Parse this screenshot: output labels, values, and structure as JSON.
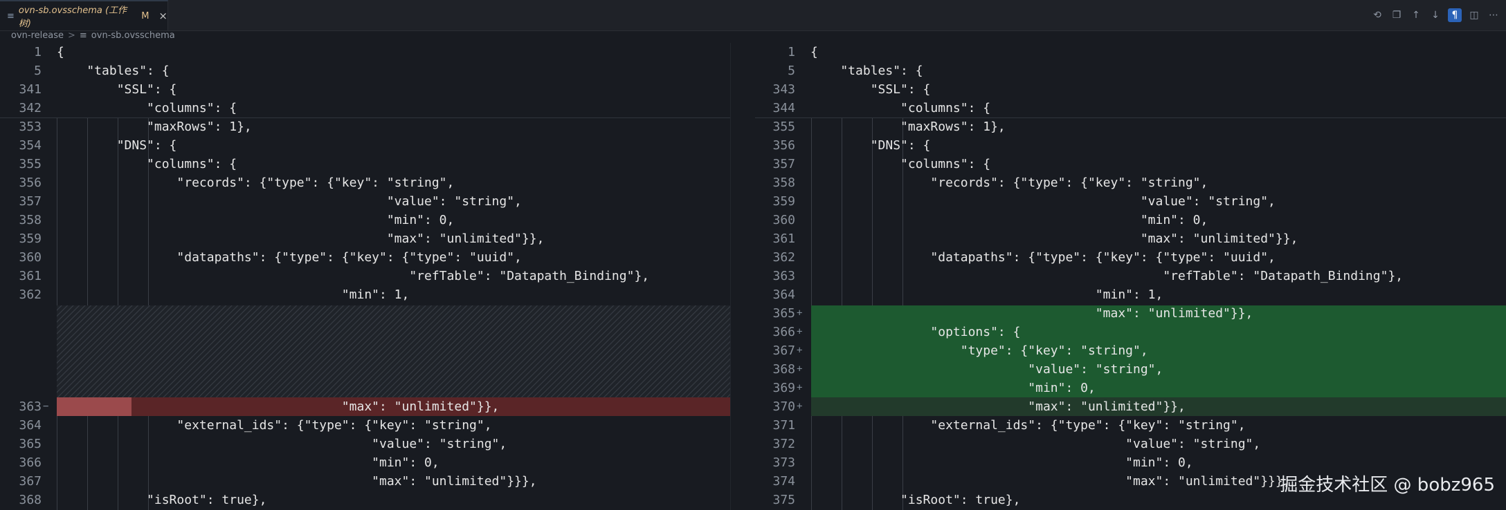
{
  "tab": {
    "file_icon": "≡",
    "label": "ovn-sb.ovsschema (工作树)",
    "badge": "M",
    "close": "×"
  },
  "actions": [
    {
      "name": "history-icon",
      "glyph": "⟲"
    },
    {
      "name": "open-file-icon",
      "glyph": "❐"
    },
    {
      "name": "previous-change-icon",
      "glyph": "↑"
    },
    {
      "name": "next-change-icon",
      "glyph": "↓"
    },
    {
      "name": "whitespace-toggle-icon",
      "glyph": "¶"
    },
    {
      "name": "inline-view-icon",
      "glyph": "◫"
    },
    {
      "name": "more-actions-icon",
      "glyph": "⋯"
    }
  ],
  "breadcrumb": {
    "folder": "ovn-release",
    "separator": ">",
    "file_icon": "≡",
    "file": "ovn-sb.ovsschema"
  },
  "left_lines": [
    {
      "num": "1",
      "code": "{"
    },
    {
      "num": "5",
      "code": "    \"tables\": {"
    },
    {
      "num": "341",
      "code": "        \"SSL\": {"
    },
    {
      "num": "342",
      "code": "            \"columns\": {"
    },
    {
      "num": "353",
      "code": "            \"maxRows\": 1},"
    },
    {
      "num": "354",
      "code": "        \"DNS\": {"
    },
    {
      "num": "355",
      "code": "            \"columns\": {"
    },
    {
      "num": "356",
      "code": "                \"records\": {\"type\": {\"key\": \"string\","
    },
    {
      "num": "357",
      "code": "                                            \"value\": \"string\","
    },
    {
      "num": "358",
      "code": "                                            \"min\": 0,"
    },
    {
      "num": "359",
      "code": "                                            \"max\": \"unlimited\"}},"
    },
    {
      "num": "360",
      "code": "                \"datapaths\": {\"type\": {\"key\": {\"type\": \"uuid\","
    },
    {
      "num": "361",
      "code": "                                               \"refTable\": \"Datapath_Binding\"},"
    },
    {
      "num": "362",
      "code": "                                      \"min\": 1,"
    },
    {
      "num": "363",
      "code": "                                      \"max\": \"unlimited\"}},"
    },
    {
      "num": "364",
      "code": "                \"external_ids\": {\"type\": {\"key\": \"string\","
    },
    {
      "num": "365",
      "code": "                                          \"value\": \"string\","
    },
    {
      "num": "366",
      "code": "                                          \"min\": 0,"
    },
    {
      "num": "367",
      "code": "                                          \"max\": \"unlimited\"}}},"
    },
    {
      "num": "368",
      "code": "            \"isRoot\": true},"
    }
  ],
  "right_lines": [
    {
      "num": "1",
      "code": "{"
    },
    {
      "num": "5",
      "code": "    \"tables\": {"
    },
    {
      "num": "343",
      "code": "        \"SSL\": {"
    },
    {
      "num": "344",
      "code": "            \"columns\": {"
    },
    {
      "num": "355",
      "code": "            \"maxRows\": 1},"
    },
    {
      "num": "356",
      "code": "        \"DNS\": {"
    },
    {
      "num": "357",
      "code": "            \"columns\": {"
    },
    {
      "num": "358",
      "code": "                \"records\": {\"type\": {\"key\": \"string\","
    },
    {
      "num": "359",
      "code": "                                            \"value\": \"string\","
    },
    {
      "num": "360",
      "code": "                                            \"min\": 0,"
    },
    {
      "num": "361",
      "code": "                                            \"max\": \"unlimited\"}},"
    },
    {
      "num": "362",
      "code": "                \"datapaths\": {\"type\": {\"key\": {\"type\": \"uuid\","
    },
    {
      "num": "363",
      "code": "                                               \"refTable\": \"Datapath_Binding\"},"
    },
    {
      "num": "364",
      "code": "                                      \"min\": 1,"
    },
    {
      "num": "365",
      "code": "                                      \"max\": \"unlimited\"}},"
    },
    {
      "num": "366",
      "code": "                \"options\": {"
    },
    {
      "num": "367",
      "code": "                    \"type\": {\"key\": \"string\","
    },
    {
      "num": "368",
      "code": "                             \"value\": \"string\","
    },
    {
      "num": "369",
      "code": "                             \"min\": 0,"
    },
    {
      "num": "370",
      "code": "                             \"max\": \"unlimited\"}},"
    },
    {
      "num": "371",
      "code": "                \"external_ids\": {\"type\": {\"key\": \"string\","
    },
    {
      "num": "372",
      "code": "                                          \"value\": \"string\","
    },
    {
      "num": "373",
      "code": "                                          \"min\": 0,"
    },
    {
      "num": "374",
      "code": "                                          \"max\": \"unlimited\"}}},"
    },
    {
      "num": "375",
      "code": "            \"isRoot\": true},"
    }
  ],
  "left_marks": {
    "363": "−"
  },
  "right_marks": {
    "365": "+",
    "366": "+",
    "367": "+",
    "368": "+",
    "369": "+",
    "370": "+"
  },
  "colors": {
    "background": "#181b21",
    "deleted": "#5a2527",
    "deleted_strong": "#9b4a4c",
    "added": "#1d5a30",
    "modified_tab": "#e2c08d",
    "active_toggle": "#2b63b8"
  },
  "watermark": "掘金技术社区 @ bobz965"
}
